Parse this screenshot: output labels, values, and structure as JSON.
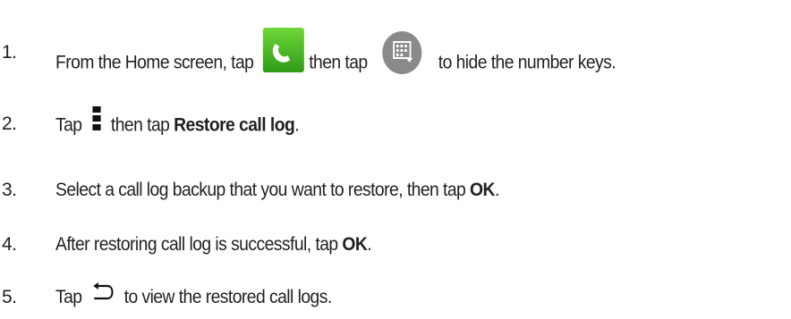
{
  "steps": [
    {
      "num": "1.",
      "before": "From the Home screen, tap ",
      "mid": "then tap",
      "after": "to hide the number keys."
    },
    {
      "num": "2.",
      "before": "Tap ",
      "mid": "then tap ",
      "bold": "Restore call log",
      "after": "."
    },
    {
      "num": "3.",
      "before": "Select a call log backup that you want to restore, then tap ",
      "bold": "OK",
      "after": "."
    },
    {
      "num": "4.",
      "before": "After restoring call log is successful, tap ",
      "bold": "OK",
      "after": "."
    },
    {
      "num": "5.",
      "before": "Tap ",
      "after": "to view the restored call logs."
    }
  ],
  "icons": {
    "step1_first": "phone-icon",
    "step1_second": "keypad-icon",
    "step2": "menu-icon",
    "step5": "back-icon"
  },
  "colors": {
    "text": "#231f20",
    "phone_icon_green": "#3fb51f",
    "keypad_icon_gray": "#8a8a8a"
  }
}
